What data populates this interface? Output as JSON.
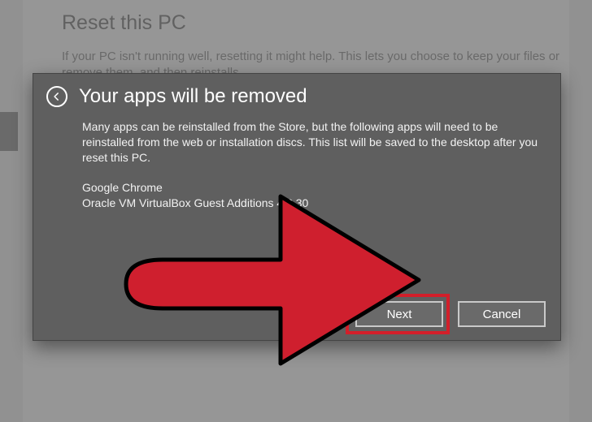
{
  "background": {
    "title": "Reset this PC",
    "description": "If your PC isn't running well, resetting it might help. This lets you choose to keep your files or remove them, and then reinstalls"
  },
  "dialog": {
    "title": "Your apps will be removed",
    "body": "Many apps can be reinstalled from the Store, but the following apps will need to be reinstalled from the web or installation discs. This list will be saved to the desktop after you reset this PC.",
    "apps": [
      "Google Chrome",
      "Oracle VM VirtualBox Guest Additions 4.3.30"
    ],
    "buttons": {
      "next": "Next",
      "cancel": "Cancel"
    }
  }
}
